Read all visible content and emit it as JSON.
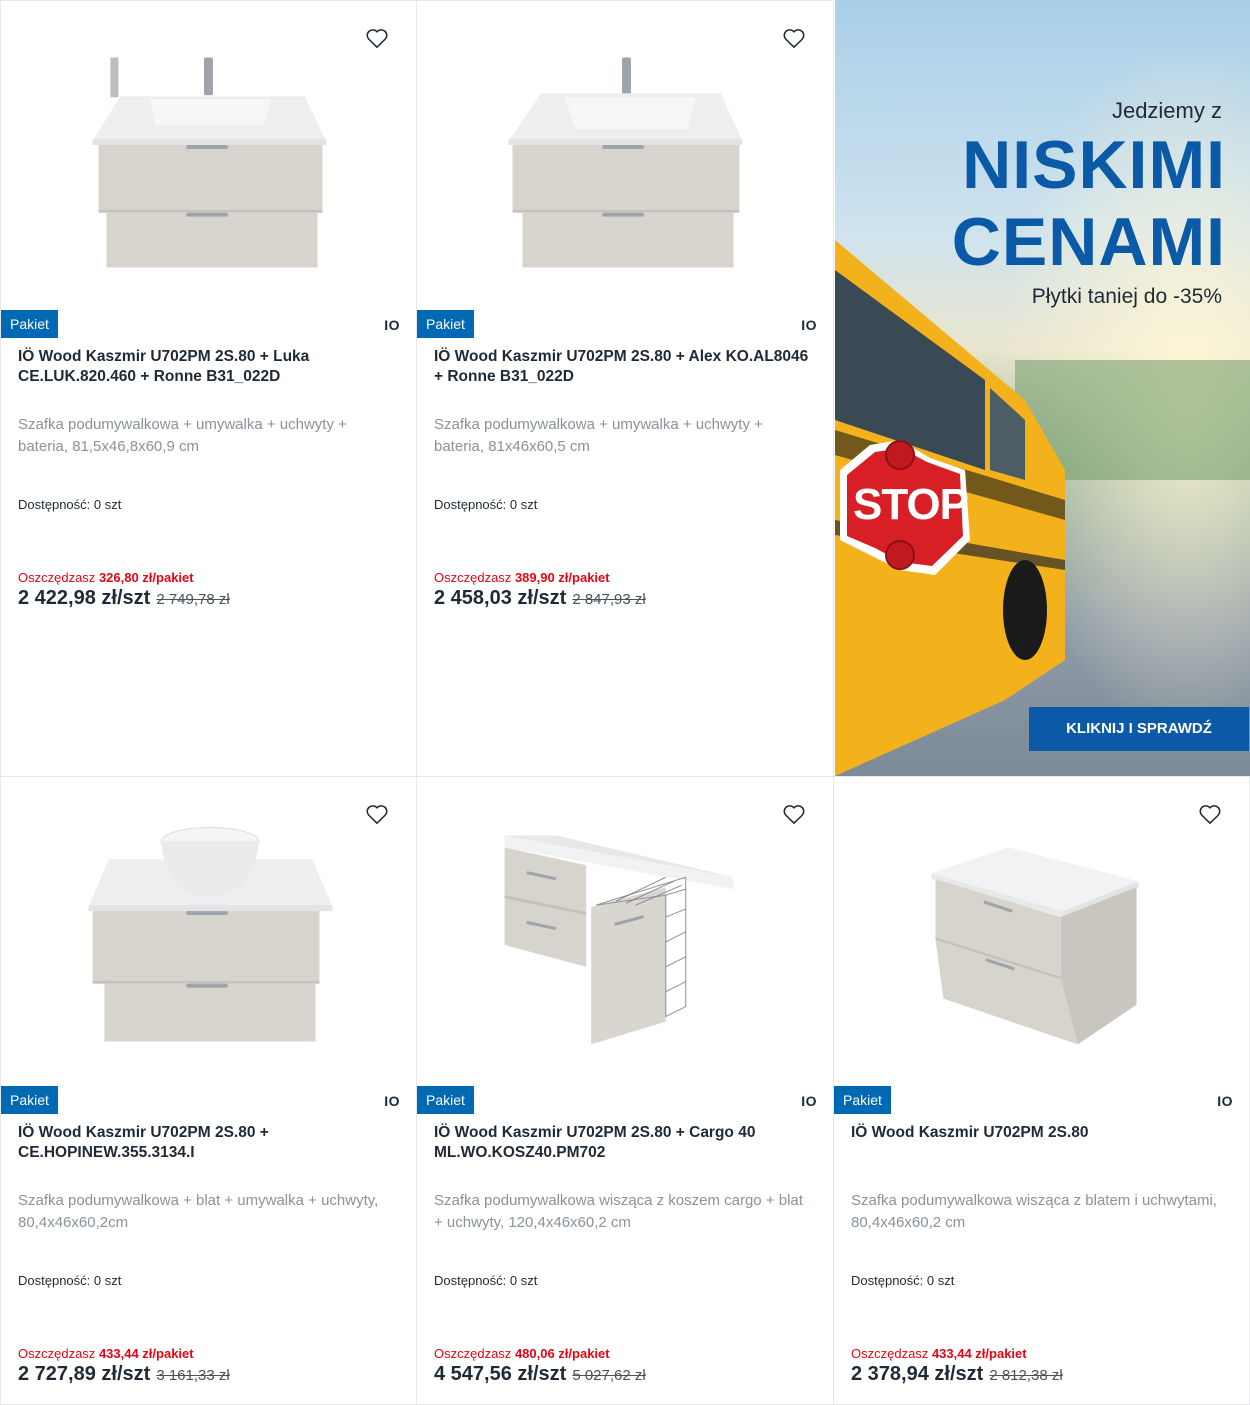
{
  "colors": {
    "accent": "#0069b4",
    "sale": "#e30613",
    "banner_blue": "#0a5aa8"
  },
  "products": [
    {
      "badge": "Pakiet",
      "brand": "IO",
      "title": "IÖ Wood Kaszmir U702PM 2S.80 + Luka CE.LUK.820.460 + Ronne B31_022D",
      "desc": "Szafka podumywalkowa + umywalka + uchwyty + bateria, 81,5x46,8x60,9 cm",
      "avail": "Dostępność: 0 szt",
      "save_label": "Oszczędzasz",
      "save_value": "326,80 zł/pakiet",
      "price": "2 422,98 zł/szt",
      "old_price": "2 749,78 zł",
      "image": "vanity-basin-faucet"
    },
    {
      "badge": "Pakiet",
      "brand": "IO",
      "title": "IÖ Wood Kaszmir U702PM 2S.80 + Alex KO.AL8046 + Ronne B31_022D",
      "desc": "Szafka podumywalkowa + umywalka + uchwyty + bateria, 81x46x60,5 cm",
      "avail": "Dostępność: 0 szt",
      "save_label": "Oszczędzasz",
      "save_value": "389,90 zł/pakiet",
      "price": "2 458,03 zł/szt",
      "old_price": "2 847,93 zł",
      "image": "vanity-basin-faucet"
    },
    {
      "badge": "Pakiet",
      "brand": "IO",
      "title": "IÖ Wood Kaszmir U702PM 2S.80 + CE.HOPINEW.355.3134.I",
      "desc": "Szafka podumywalkowa + blat + umywalka + uchwyty, 80,4x46x60,2cm",
      "avail": "Dostępność: 0 szt",
      "save_label": "Oszczędzasz",
      "save_value": "433,44 zł/pakiet",
      "price": "2 727,89 zł/szt",
      "old_price": "3 161,33 zł",
      "image": "vanity-bowl"
    },
    {
      "badge": "Pakiet",
      "brand": "IO",
      "title": "IÖ Wood Kaszmir U702PM 2S.80 + Cargo 40 ML.WO.KOSZ40.PM702",
      "desc": "Szafka podumywalkowa wisząca z koszem cargo + blat + uchwyty, 120,4x46x60,2 cm",
      "avail": "Dostępność: 0 szt",
      "save_label": "Oszczędzasz",
      "save_value": "480,06 zł/pakiet",
      "price": "4 547,56 zł/szt",
      "old_price": "5 027,62 zł",
      "image": "vanity-cargo"
    },
    {
      "badge": "Pakiet",
      "brand": "IO",
      "title": "IÖ Wood Kaszmir U702PM 2S.80",
      "desc": "Szafka podumywalkowa wisząca z blatem i uchwytami, 80,4x46x60,2 cm",
      "avail": "Dostępność: 0 szt",
      "save_label": "Oszczędzasz",
      "save_value": "433,44 zł/pakiet",
      "price": "2 378,94 zł/szt",
      "old_price": "2 812,38 zł",
      "image": "vanity-top"
    }
  ],
  "banner": {
    "line1": "Jedziemy z",
    "line2": "NISKIMI",
    "line3": "CENAMI",
    "line4": "Płytki taniej do -35%",
    "sign": "STOP",
    "cta": "KLIKNIJ I SPRAWDŹ"
  }
}
